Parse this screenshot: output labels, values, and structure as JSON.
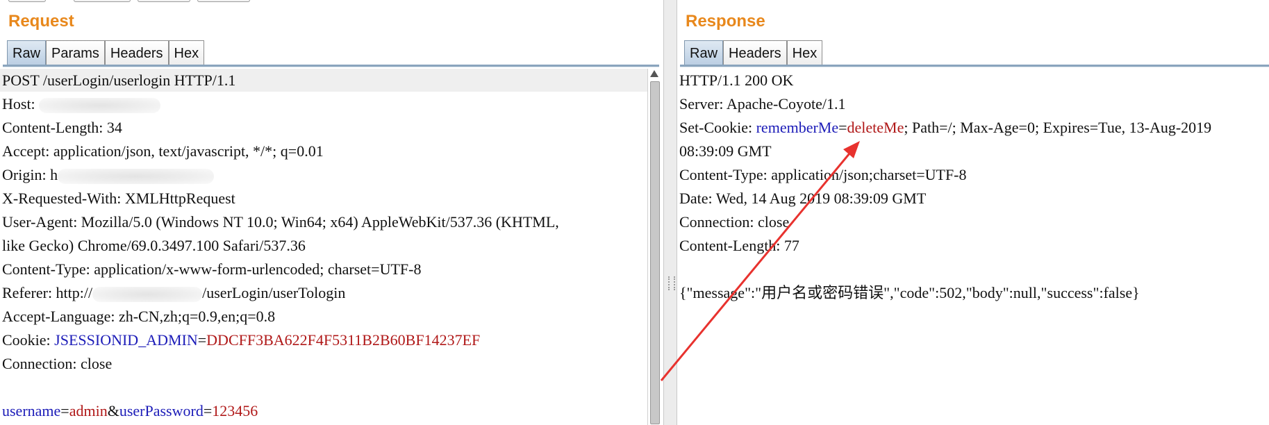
{
  "request": {
    "title": "Request",
    "tabs": [
      "Raw",
      "Params",
      "Headers",
      "Hex"
    ],
    "active_tab": "Raw",
    "lines": {
      "l0": "POST /userLogin/userlogin HTTP/1.1",
      "l1_label": "Host: ",
      "l2": "Content-Length: 34",
      "l3": "Accept: application/json, text/javascript, */*; q=0.01",
      "l4_label": "Origin: ",
      "l4_frag": "h",
      "l5": "X-Requested-With: XMLHttpRequest",
      "l6": "User-Agent: Mozilla/5.0 (Windows NT 10.0; Win64; x64) AppleWebKit/537.36 (KHTML,",
      "l7": "like Gecko) Chrome/69.0.3497.100 Safari/537.36",
      "l8": "Content-Type: application/x-www-form-urlencoded; charset=UTF-8",
      "l9_prefix": "Referer: http://",
      "l9_suffix": "/userLogin/userTologin",
      "l10": "Accept-Language: zh-CN,zh;q=0.9,en;q=0.8",
      "l11_label": "Cookie: ",
      "l11_key": "JSESSIONID_ADMIN",
      "l11_eq": "=",
      "l11_val": "DDCFF3BA622F4F5311B2B60BF14237EF",
      "l12": "Connection: close",
      "body_k1": "username",
      "body_eq1": "=",
      "body_v1": "admin",
      "body_amp": "&",
      "body_k2": "userPassword",
      "body_eq2": "=",
      "body_v2": "123456"
    }
  },
  "response": {
    "title": "Response",
    "tabs": [
      "Raw",
      "Headers",
      "Hex"
    ],
    "active_tab": "Raw",
    "lines": {
      "l0": "HTTP/1.1 200 OK",
      "l1": "Server: Apache-Coyote/1.1",
      "l2_label": "Set-Cookie: ",
      "l2_key": "rememberMe",
      "l2_eq": "=",
      "l2_val": "deleteMe",
      "l2_rest": "; Path=/; Max-Age=0; Expires=Tue, 13-Aug-2019",
      "l3": "08:39:09 GMT",
      "l4": "Content-Type: application/json;charset=UTF-8",
      "l5": "Date: Wed, 14 Aug 2019 08:39:09 GMT",
      "l6": "Connection: close",
      "l7": "Content-Length: 77",
      "l9": "{\"message\":\"用户名或密码错误\",\"code\":502,\"body\":null,\"success\":false}"
    }
  },
  "annotation": {
    "arrow_color": "#e8322e"
  },
  "colors": {
    "title": "#e8881c",
    "key": "#1c1cb8",
    "value": "#b01818"
  }
}
